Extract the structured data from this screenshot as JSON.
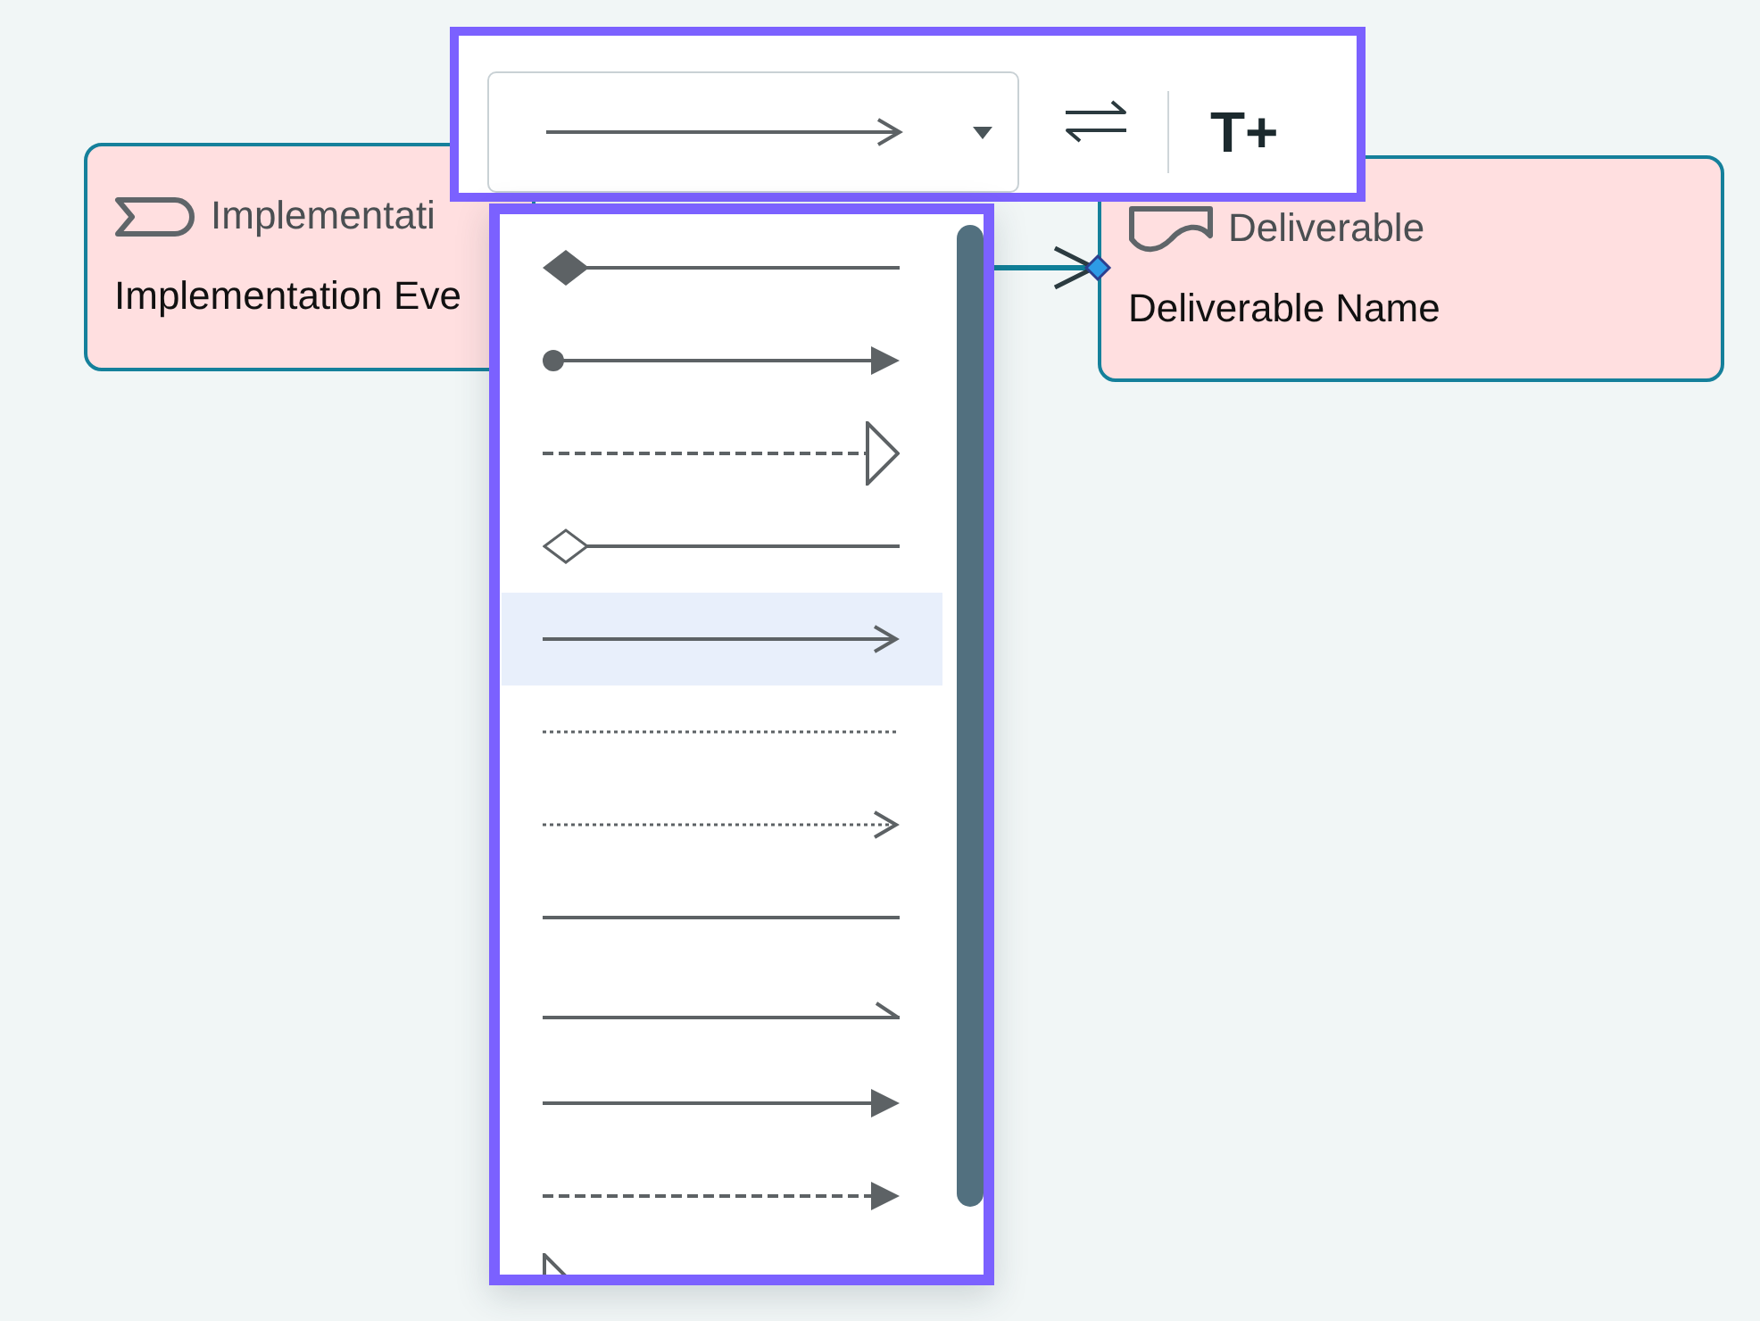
{
  "canvas": {
    "nodes": [
      {
        "kind": "event",
        "type_label": "Implementati",
        "name": "Implementation Eve"
      },
      {
        "kind": "deliverable",
        "type_label": "Deliverable",
        "name": "Deliverable Name"
      }
    ],
    "connector": {
      "selected": true
    }
  },
  "toolbar": {
    "line_style": {
      "kind": "open-arrow"
    },
    "buttons": [
      {
        "kind": "swap"
      },
      {
        "kind": "text",
        "label": "T+"
      }
    ]
  },
  "line_style_menu": {
    "options": [
      {
        "kind": "filled-diamond",
        "cut_off": false,
        "selected": false
      },
      {
        "kind": "dot-filled-arrow",
        "cut_off": false,
        "selected": false
      },
      {
        "kind": "dashed-hollow-triangle",
        "cut_off": false,
        "selected": false
      },
      {
        "kind": "hollow-diamond",
        "cut_off": false,
        "selected": false
      },
      {
        "kind": "open-arrow",
        "cut_off": false,
        "selected": true
      },
      {
        "kind": "dotted",
        "cut_off": false,
        "selected": false
      },
      {
        "kind": "dotted-open-arrow",
        "cut_off": false,
        "selected": false
      },
      {
        "kind": "plain",
        "cut_off": false,
        "selected": false
      },
      {
        "kind": "half-arrow",
        "cut_off": false,
        "selected": false
      },
      {
        "kind": "filled-arrow",
        "cut_off": false,
        "selected": false
      },
      {
        "kind": "dashed-filled-arrow",
        "cut_off": false,
        "selected": false
      },
      {
        "kind": "hollow-triangle",
        "cut_off": true,
        "selected": false
      }
    ]
  }
}
